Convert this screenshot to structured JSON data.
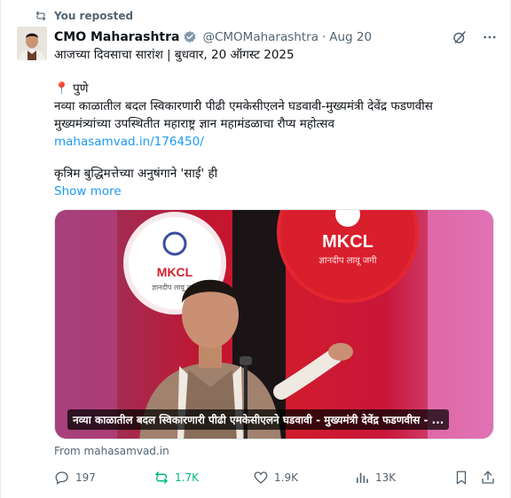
{
  "repost": {
    "label": "You reposted",
    "icon": "repost-icon"
  },
  "author": {
    "name": "CMO Maharashtra",
    "handle": "@CMOMaharashtra",
    "separator": "·",
    "date": "Aug 20",
    "verified_color": "#829aab"
  },
  "tweet": {
    "line1": "आजच्या दिवसाचा सारांश | बुधवार, 20 ऑगस्ट 2025",
    "location_pin": "📍",
    "location": "पुणे",
    "line3": "नव्या काळातील बदल स्विकारणारी पीढी एमकेसीएलने घडवावी-मुख्यमंत्री देवेंद्र फडणवीस",
    "line4": "मुख्यमंत्र्यांच्या उपस्थितीत महाराष्ट्र ज्ञान महामंडळाचा रौप्य महोत्सव",
    "link": "mahasamvad.in/176450/",
    "line6": "कृत्रिम बुद्धिमत्तेच्या अनुषंगाने 'साई' ही",
    "show_more": "Show more"
  },
  "media": {
    "caption": "नव्या काळातील बदल स्विकारणारी पीढी एमकेसीएलने घडवावी - मुख्यमंत्री देवेंद्र फडणवीस - ...",
    "logo_text": "MKCL",
    "logo_tagline": "ज्ञानदीप लावू जगी"
  },
  "from_label": "From mahasamvad.in",
  "actions": {
    "replies": "197",
    "reposts": "1.7K",
    "likes": "1.9K",
    "views": "13K"
  },
  "colors": {
    "accent": "#1d9bf0",
    "repost_green": "#00ba7c",
    "muted": "#536471"
  }
}
